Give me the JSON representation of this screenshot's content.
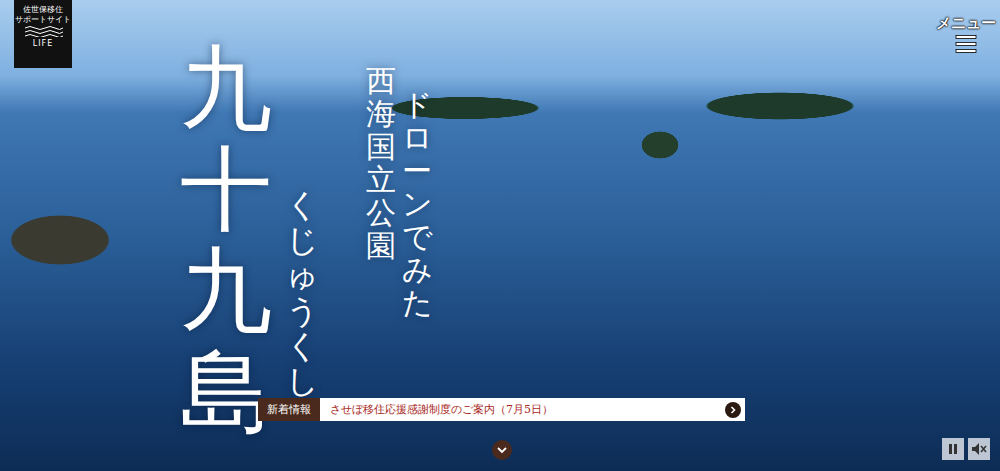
{
  "logo": {
    "lines": [
      "佐世保移住",
      "サポートサイト"
    ],
    "brand": "LIFE"
  },
  "menu": {
    "label": "メニュー"
  },
  "hero": {
    "title": "九十九島",
    "reading": "くじゅうくし",
    "subtitle": [
      "ドローンでみた",
      "西海国立公園"
    ]
  },
  "news": {
    "label": "新着情報",
    "text": "させぼ移住応援感謝制度のご案内（7月5日）"
  },
  "controls": {
    "paused": false,
    "muted": true
  }
}
